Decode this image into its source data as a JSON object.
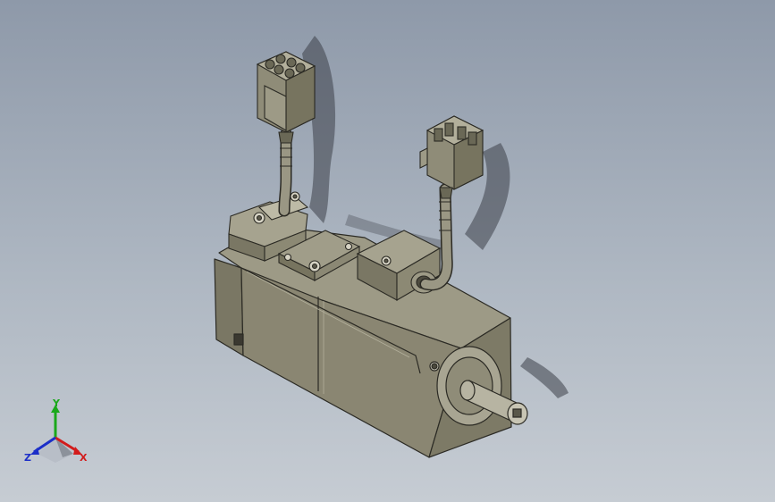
{
  "scene": {
    "background_top": "#8e99a9",
    "background_bottom": "#c6ccd3",
    "body_color": "#8a8672",
    "body_light": "#9d9a86",
    "body_dark": "#5e5b4c"
  },
  "triad": {
    "x_label": "X",
    "y_label": "Y",
    "z_label": "Z",
    "x_color": "#d21c1c",
    "y_color": "#1aa81a",
    "z_color": "#1c2fc8"
  }
}
